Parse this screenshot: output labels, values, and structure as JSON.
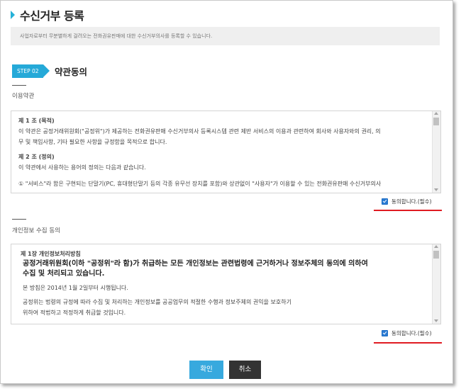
{
  "header": {
    "title": "수신거부 등록",
    "notice": "사업자로부터 무분별하게 걸려오는 전화권유판매에 대한 수신거부의사를 등록할 수 있습니다."
  },
  "step": {
    "badge": "STEP 02",
    "title": "약관동의"
  },
  "terms": {
    "section_label": "이용약관",
    "article1_heading": "제 1 조 (목적)",
    "article1_line1": "이 약관은 공정거래위원회(\"공정위\")가 제공하는 전화권유판매 수신거부의사 등록시스템 관련 제반 서비스의 이용과 관련하여 회사와 사용자와의 권리, 의",
    "article1_line2": "무 및 책임사항, 기타 필요한 사항을 규정함을 목적으로 합니다.",
    "article2_heading": "제 2 조 (정의)",
    "article2_line1": "이 약관에서 사용하는 용어의 정의는 다음과 같습니다.",
    "article2_item1": "① \"서비스\"라 함은 구현되는 단말기(PC, 휴대형단말기 등의 각종 유무선 장치를 포함)와 상관없이 \"사용자\"가 이용할 수 있는 전화권유판매 수신거부의사",
    "agree_label": "동의합니다.(필수)",
    "agree_checked": true
  },
  "privacy": {
    "section_label": "개인정보 수집 동의",
    "chapter_heading": "제 1장 개인정보처리방침",
    "lead_line1": "공정거래위원회(이하 \"공정위\"라 함)가 취급하는 모든 개인정보는 관련법령에 근거하거나 정보주체의 동의에 의하여",
    "lead_line2": "수집 및 처리되고 있습니다.",
    "effective": "본 방침은 2014년 1월 2일부터 시행됩니다.",
    "body_line1": "공정위는 법령의 규정에 따라 수집 및 처리하는 개인정보를 공공업무의 적절한 수행과 정보주체의 권익을 보호하기",
    "body_line2": "위하여 적법하고 적정하게 취급할 것입니다.",
    "agree_label": "동의합니다.(필수)",
    "agree_checked": true
  },
  "buttons": {
    "confirm": "확인",
    "cancel": "취소"
  },
  "colors": {
    "accent": "#25a9d8",
    "highlight": "#e01b22",
    "cancel_button": "#333333"
  }
}
